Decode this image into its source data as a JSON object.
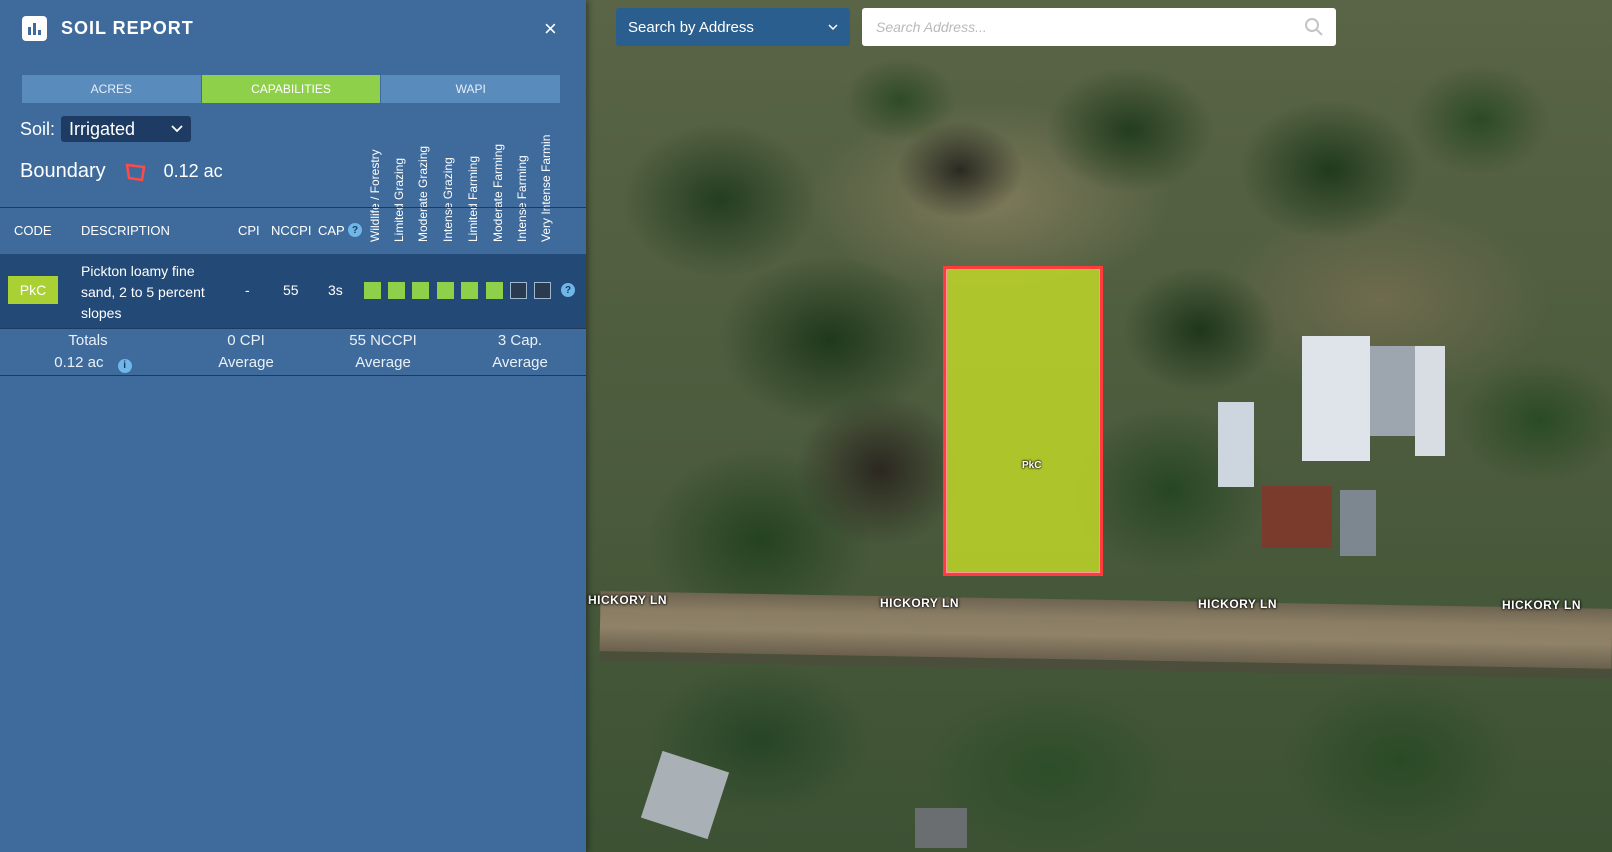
{
  "panel": {
    "title": "SOIL REPORT",
    "close_glyph": "×",
    "tabs": [
      {
        "label": "ACRES",
        "active": false
      },
      {
        "label": "CAPABILITIES",
        "active": true
      },
      {
        "label": "WAPI",
        "active": false
      }
    ],
    "soil_label": "Soil:",
    "soil_selected": "Irrigated",
    "boundary_label": "Boundary",
    "boundary_acres": "0.12 ac",
    "capability_headers": [
      "Wildlife / Forestry",
      "Limited Grazing",
      "Moderate Grazing",
      "Intense Grazing",
      "Limited Farming",
      "Moderate Farming",
      "Intense Farming",
      "Very Intense Farmin"
    ],
    "columns": {
      "code": "CODE",
      "description": "DESCRIPTION",
      "cpi": "CPI",
      "nccpi": "NCCPI",
      "cap": "CAP"
    },
    "rows": [
      {
        "code": "PkC",
        "description": "Pickton loamy fine sand, 2 to 5 percent slopes",
        "cpi": "-",
        "nccpi": "55",
        "cap": "3s",
        "capability_fill": [
          true,
          true,
          true,
          true,
          true,
          true,
          false,
          false
        ]
      }
    ],
    "totals": {
      "label": "Totals",
      "acres": "0.12 ac",
      "cpi": "0 CPI",
      "cpi_sub": "Average",
      "nccpi": "55 NCCPI",
      "nccpi_sub": "Average",
      "cap": "3 Cap.",
      "cap_sub": "Average"
    },
    "colors": {
      "panel_bg": "#3e6b9b",
      "accent_green": "#8ed04a",
      "badge_green": "#a9d133"
    }
  },
  "search": {
    "mode": "Search by Address",
    "placeholder": "Search Address..."
  },
  "map": {
    "road_labels": [
      "HICKORY LN",
      "HICKORY LN",
      "HICKORY LN",
      "HICKORY LN"
    ],
    "parcel_label": "PkC",
    "parcel_border_color": "#ff3b3b",
    "parcel_fill_color": "#bed728"
  }
}
